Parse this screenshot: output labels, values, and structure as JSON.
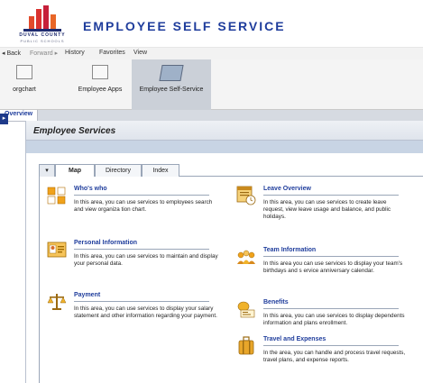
{
  "header": {
    "logo_line1": "DUVAL COUNTY",
    "logo_line2": "PUBLIC SCHOOLS",
    "title": "EMPLOYEE SELF SERVICE"
  },
  "history_bar": {
    "back": "◂ Back",
    "forward": "Forward ▸",
    "history": "History",
    "favorites": "Favorites",
    "view": "View"
  },
  "top_nav": [
    {
      "label": "orgchart"
    },
    {
      "label": "Employee Apps"
    },
    {
      "label": "Employee Self-Service"
    }
  ],
  "sub_nav": {
    "overview": "Overview"
  },
  "panel": {
    "title": "Employee Services",
    "tabs": {
      "map": "Map",
      "directory": "Directory",
      "index": "Index"
    }
  },
  "services": [
    {
      "name": "Who's who",
      "desc": "In this area, you can use services to employees search and view organiza tion chart.",
      "icon": "org-tiles-icon"
    },
    {
      "name": "Personal Information",
      "desc": "In this area, you can use services to maintain and display your personal data.",
      "icon": "id-card-icon"
    },
    {
      "name": "Payment",
      "desc": "In this area, you can use services to display your salary statement and other information regarding your payment.",
      "icon": "scales-icon"
    },
    {
      "name": "Leave Overview",
      "desc": "In this area, you can use services to create leave request, view leave usage and balance, and public holidays.",
      "icon": "calendar-clock-icon"
    },
    {
      "name": "Team Information",
      "desc": "In this area you can use services to display your team's birthdays and s ervice anniversary calendar.",
      "icon": "team-icon"
    },
    {
      "name": "Benefits",
      "desc": "In this area, you can use services to display dependents information and plans enrollment.",
      "icon": "coins-icon"
    },
    {
      "name": "Travel and Expenses",
      "desc": "In the area, you can handle and process travel requests, travel plans, and expense reports.",
      "icon": "luggage-icon"
    }
  ]
}
